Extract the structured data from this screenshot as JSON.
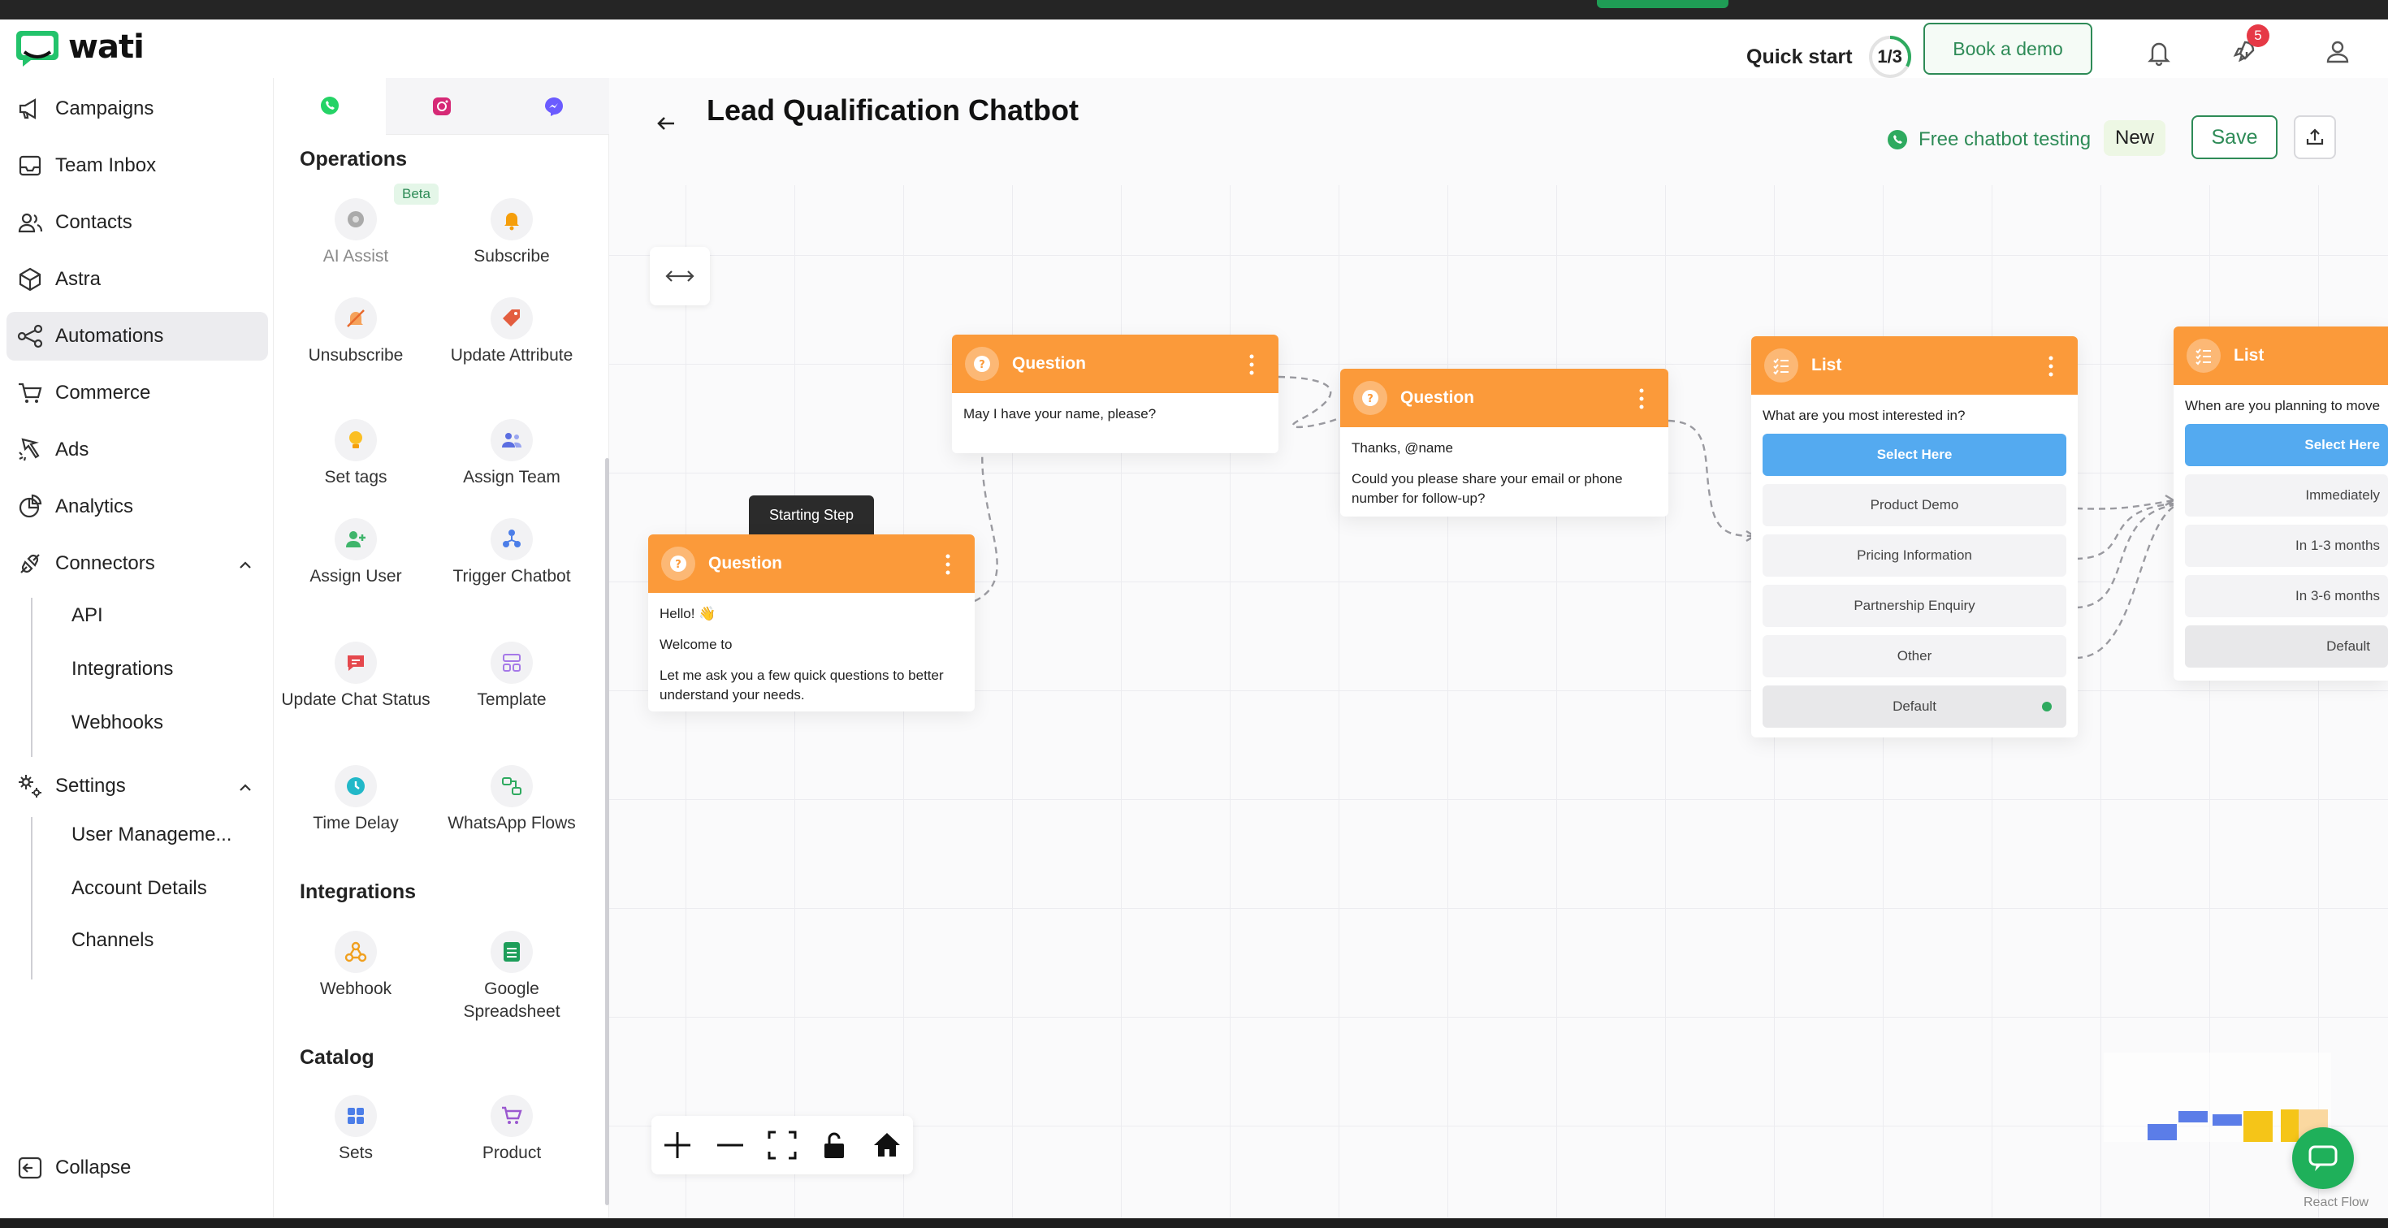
{
  "header": {
    "logo_text": "wati",
    "quick_start_label": "Quick start",
    "quick_start_progress": "1/3",
    "quick_start_fraction": 0.33,
    "book_demo_label": "Book a demo",
    "notification_badge": "5",
    "accent_color": "#2e8b57"
  },
  "sidebar": {
    "items": [
      {
        "label": "Campaigns",
        "icon": "megaphone-icon"
      },
      {
        "label": "Team Inbox",
        "icon": "inbox-icon"
      },
      {
        "label": "Contacts",
        "icon": "contacts-icon"
      },
      {
        "label": "Astra",
        "icon": "astra-icon"
      },
      {
        "label": "Automations",
        "icon": "automations-icon",
        "active": true
      },
      {
        "label": "Commerce",
        "icon": "cart-icon"
      },
      {
        "label": "Ads",
        "icon": "ads-icon"
      },
      {
        "label": "Analytics",
        "icon": "analytics-icon"
      },
      {
        "label": "Connectors",
        "icon": "connectors-icon"
      }
    ],
    "connectors_sub": [
      "API",
      "Integrations",
      "Webhooks"
    ],
    "settings_label": "Settings",
    "settings_sub": [
      "User Manageme...",
      "Account Details",
      "Channels"
    ],
    "collapse_label": "Collapse"
  },
  "palette": {
    "tabs": [
      "whatsapp-icon",
      "instagram-icon",
      "messenger-icon"
    ],
    "operations_title": "Operations",
    "beta_label": "Beta",
    "operations": [
      {
        "label": "AI Assist",
        "icon": "ai-assist-icon"
      },
      {
        "label": "Subscribe",
        "icon": "bell-icon"
      },
      {
        "label": "Unsubscribe",
        "icon": "bell-off-icon"
      },
      {
        "label": "Update Attribute",
        "icon": "tag-icon"
      },
      {
        "label": "Set tags",
        "icon": "bulb-icon"
      },
      {
        "label": "Assign Team",
        "icon": "team-icon"
      },
      {
        "label": "Assign User",
        "icon": "user-plus-icon"
      },
      {
        "label": "Trigger Chatbot",
        "icon": "chatbot-icon"
      },
      {
        "label": "Update Chat Status",
        "icon": "chat-status-icon"
      },
      {
        "label": "Template",
        "icon": "template-icon"
      },
      {
        "label": "Time Delay",
        "icon": "clock-icon"
      },
      {
        "label": "WhatsApp Flows",
        "icon": "flows-icon"
      }
    ],
    "integrations_title": "Integrations",
    "integrations": [
      {
        "label": "Webhook",
        "icon": "webhook-icon"
      },
      {
        "label": "Google Spreadsheet",
        "icon": "spreadsheet-icon"
      }
    ],
    "catalog_title": "Catalog",
    "catalog": [
      {
        "label": "Sets",
        "icon": "grid-icon"
      },
      {
        "label": "Product",
        "icon": "cart-icon"
      }
    ]
  },
  "canvas": {
    "title": "Lead Qualification Chatbot",
    "free_test_label": "Free chatbot testing",
    "new_label": "New",
    "save_label": "Save",
    "starting_step_label": "Starting Step",
    "react_flow_label": "React Flow"
  },
  "nodes": {
    "start": {
      "type": "Question",
      "lines": [
        "Hello! 👋",
        "Welcome to",
        "Let me ask you a few quick questions to better understand your needs."
      ]
    },
    "q1": {
      "type": "Question",
      "lines": [
        "May I have your name, please?"
      ]
    },
    "q2": {
      "type": "Question",
      "lines": [
        "Thanks, @name",
        "Could you please share your email or phone number for follow-up?"
      ]
    },
    "list1": {
      "type": "List",
      "question": "What are you most interested in?",
      "button": "Select Here",
      "options": [
        "Product Demo",
        "Pricing Information",
        "Partnership Enquiry",
        "Other",
        "Default"
      ]
    },
    "list2": {
      "type": "List",
      "question": "When are you planning to move",
      "button": "Select Here",
      "options": [
        "Immediately",
        "In 1-3 months",
        "In 3-6 months",
        "Default"
      ]
    }
  },
  "colors": {
    "node_header": "#fb9a3a",
    "list_primary": "#54aaf0",
    "brand_green": "#1fb05a"
  }
}
